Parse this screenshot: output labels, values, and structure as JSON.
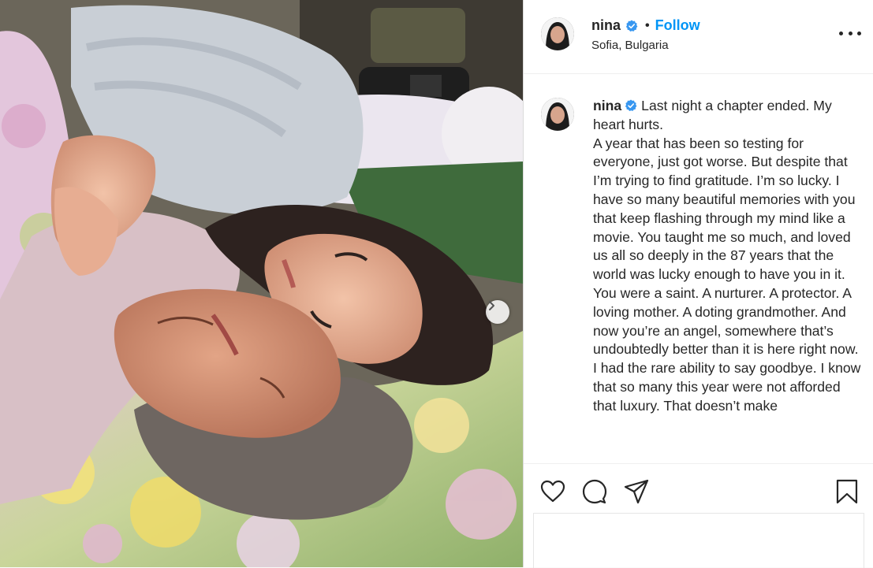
{
  "post": {
    "username": "nina",
    "separator": "•",
    "follow_label": "Follow",
    "location": "Sofia, Bulgaria",
    "caption_paragraphs": [
      "Last night a chapter ended. My heart hurts.",
      "A year that has been so testing for everyone, just got worse. But despite that I’m trying to find gratitude. I’m so lucky. I have so many beautiful memories with you that keep flashing through my mind like a movie. You taught me so much, and loved us all so deeply in the 87 years that the world was lucky enough to have you in it. You were a saint. A nurturer. A protector. A loving mother. A doting grandmother. And now you’re an angel, somewhere that’s undoubtedly better than it is here right now.",
      "I had the rare ability to say goodbye. I know that so many this year were not afforded that luxury. That doesn’t make"
    ]
  },
  "icons": {
    "verified": "verified-badge-icon",
    "more": "more-options-icon",
    "like": "heart-icon",
    "comment": "comment-icon",
    "share": "share-icon",
    "save": "bookmark-icon",
    "next": "chevron-right-icon"
  },
  "colors": {
    "accent": "#0095f6",
    "text": "#262626",
    "border": "#dbdbdb"
  }
}
